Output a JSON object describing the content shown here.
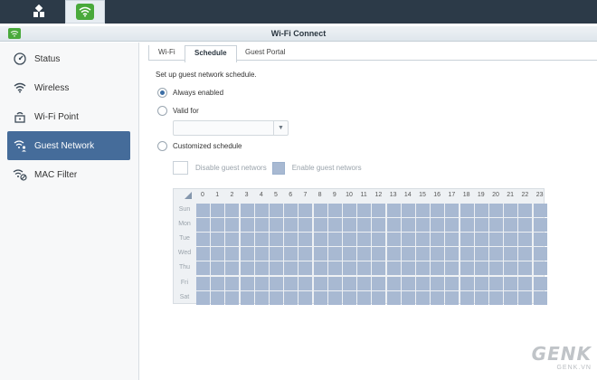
{
  "window": {
    "title": "Wi-Fi Connect"
  },
  "sidebar": {
    "items": [
      {
        "label": "Status",
        "icon": "status-gauge-icon"
      },
      {
        "label": "Wireless",
        "icon": "wifi-icon"
      },
      {
        "label": "Wi-Fi Point",
        "icon": "wifi-point-icon"
      },
      {
        "label": "Guest Network",
        "icon": "guest-network-icon",
        "active": true
      },
      {
        "label": "MAC Filter",
        "icon": "mac-filter-icon"
      }
    ]
  },
  "tabs": [
    {
      "label": "Wi-Fi"
    },
    {
      "label": "Schedule",
      "active": true
    },
    {
      "label": "Guest Portal"
    }
  ],
  "schedule": {
    "description": "Set up guest network schedule.",
    "options": {
      "always": "Always enabled",
      "valid": "Valid for",
      "custom": "Customized schedule"
    },
    "selected": "always",
    "duration_placeholder": "",
    "legend": {
      "disable": "Disable guest networs",
      "enable": "Enable guest networs"
    },
    "hours": [
      "0",
      "1",
      "2",
      "3",
      "4",
      "5",
      "6",
      "7",
      "8",
      "9",
      "10",
      "11",
      "12",
      "13",
      "14",
      "15",
      "16",
      "17",
      "18",
      "19",
      "20",
      "21",
      "22",
      "23"
    ],
    "days": [
      "Sun",
      "Mon",
      "Tue",
      "Wed",
      "Thu",
      "Fri",
      "Sat"
    ],
    "all_enabled": true
  },
  "watermark": {
    "brand": "GENK",
    "site": "GENK.VN"
  },
  "colors": {
    "taskbar": "#2c3a48",
    "accent_green": "#49a93b",
    "active_nav": "#456c9a",
    "enabled_cell": "#a8b9d2"
  }
}
